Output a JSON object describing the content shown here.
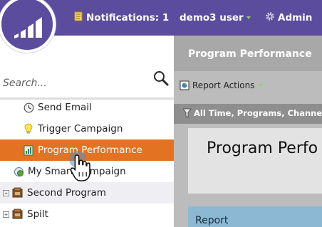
{
  "header": {
    "notifications_label": "Notifications: 1",
    "user_label": "demo3 user",
    "admin_label": "Admin",
    "brand_color": "#5b4c9e"
  },
  "sidebar": {
    "search_placeholder": "Search...",
    "items": [
      {
        "label": "Send Email",
        "icon": "clock-icon"
      },
      {
        "label": "Trigger Campaign",
        "icon": "lightbulb-icon"
      },
      {
        "label": "Program Performance",
        "icon": "report-icon",
        "selected": true
      },
      {
        "label": "My Smart Campaign",
        "icon": "smart-campaign-icon"
      },
      {
        "label": "Second Program",
        "icon": "program-folder-icon"
      },
      {
        "label": "Spilt",
        "icon": "program-folder-icon"
      }
    ],
    "selected_color": "#e37222"
  },
  "main": {
    "title": "Program Performance",
    "report_actions_label": "Report Actions",
    "filter_label": "All Time, Programs, Channel",
    "card_title": "Program Perfo",
    "report_label": "Report"
  }
}
